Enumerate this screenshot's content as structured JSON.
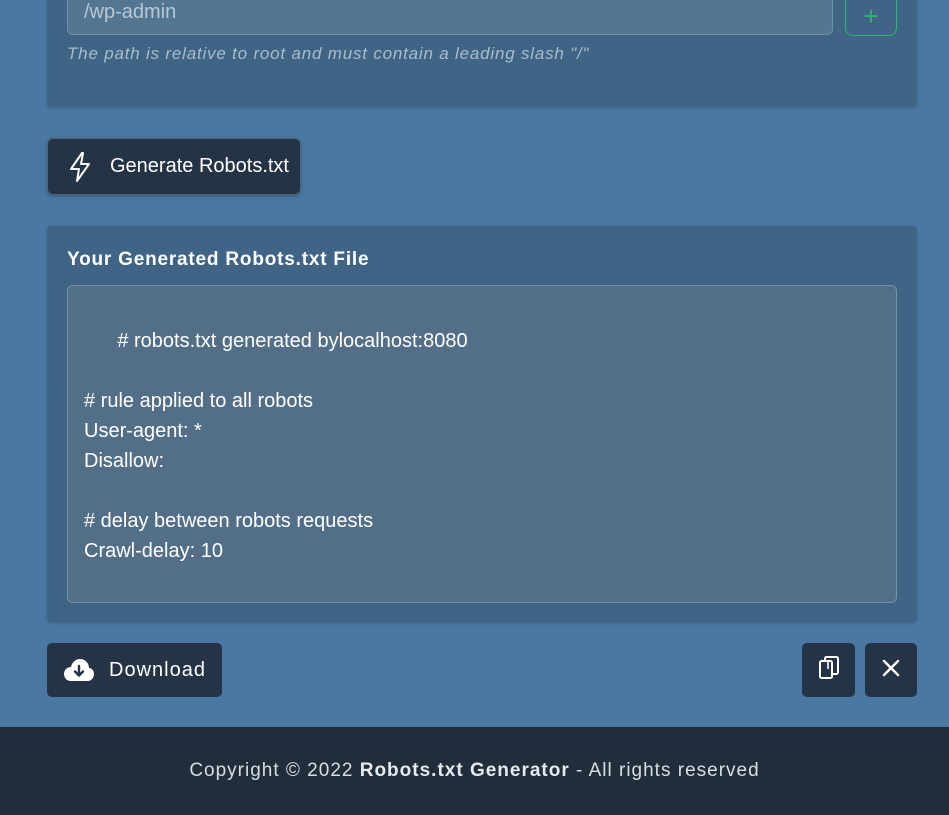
{
  "disallow_section": {
    "path_value": "/wp-admin",
    "add_button_symbol": "+",
    "hint": "The path is relative to root and must contain a leading slash \"/\""
  },
  "generate_button": {
    "icon": "lightning-bolt-icon",
    "label": "Generate Robots.txt"
  },
  "result": {
    "title": "Your Generated Robots.txt File",
    "content": "# robots.txt generated bylocalhost:8080\n\n# rule applied to all robots\nUser-agent: *\nDisallow:\n\n# delay between robots requests\nCrawl-delay: 10"
  },
  "actions": {
    "download_label": "Download",
    "download_icon": "cloud-download-icon",
    "copy_icon": "copy-icon",
    "close_icon": "close-icon"
  },
  "footer": {
    "prefix": "Copyright © 2022 ",
    "brand": "Robots.txt Generator",
    "suffix": " - All rights reserved"
  },
  "colors": {
    "page_background": "#4a78a2",
    "card_background": "#3f6486",
    "button_dark": "#243446",
    "accent_green": "#2fb36e",
    "footer_background": "#222d3c"
  }
}
